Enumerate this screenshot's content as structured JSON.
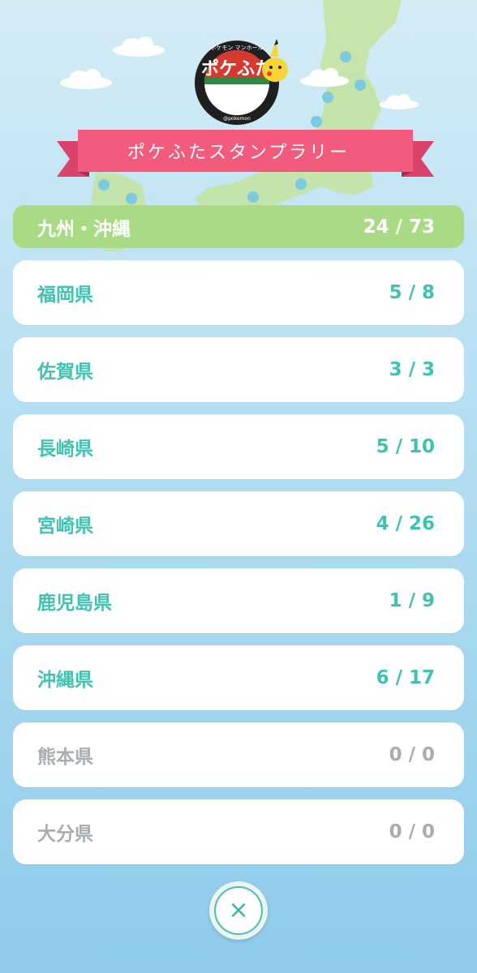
{
  "banner": {
    "title": "ポケふたスタンプラリー"
  },
  "logo": {
    "text": "ポケふた",
    "subtext": "ポケモン マンホール",
    "badge_text": "@pokemon"
  },
  "region": {
    "name": "九州・沖縄",
    "count": "24 / 73"
  },
  "prefectures": [
    {
      "name": "福岡県",
      "count": "5 / 8",
      "active": true
    },
    {
      "name": "佐賀県",
      "count": "3 / 3",
      "active": true
    },
    {
      "name": "長崎県",
      "count": "5 / 10",
      "active": true
    },
    {
      "name": "宮崎県",
      "count": "4 / 26",
      "active": true
    },
    {
      "name": "鹿児島県",
      "count": "1 / 9",
      "active": true
    },
    {
      "name": "沖縄県",
      "count": "6 / 17",
      "active": true
    },
    {
      "name": "熊本県",
      "count": "0 / 0",
      "active": false
    },
    {
      "name": "大分県",
      "count": "0 / 0",
      "active": false
    }
  ],
  "close_button": {
    "icon": "close-icon",
    "label": "×"
  },
  "colors": {
    "accent_teal": "#3ec3b2",
    "inactive_gray": "#a7adb0",
    "region_green": "#a9db85",
    "banner_pink": "#f25a7e"
  }
}
